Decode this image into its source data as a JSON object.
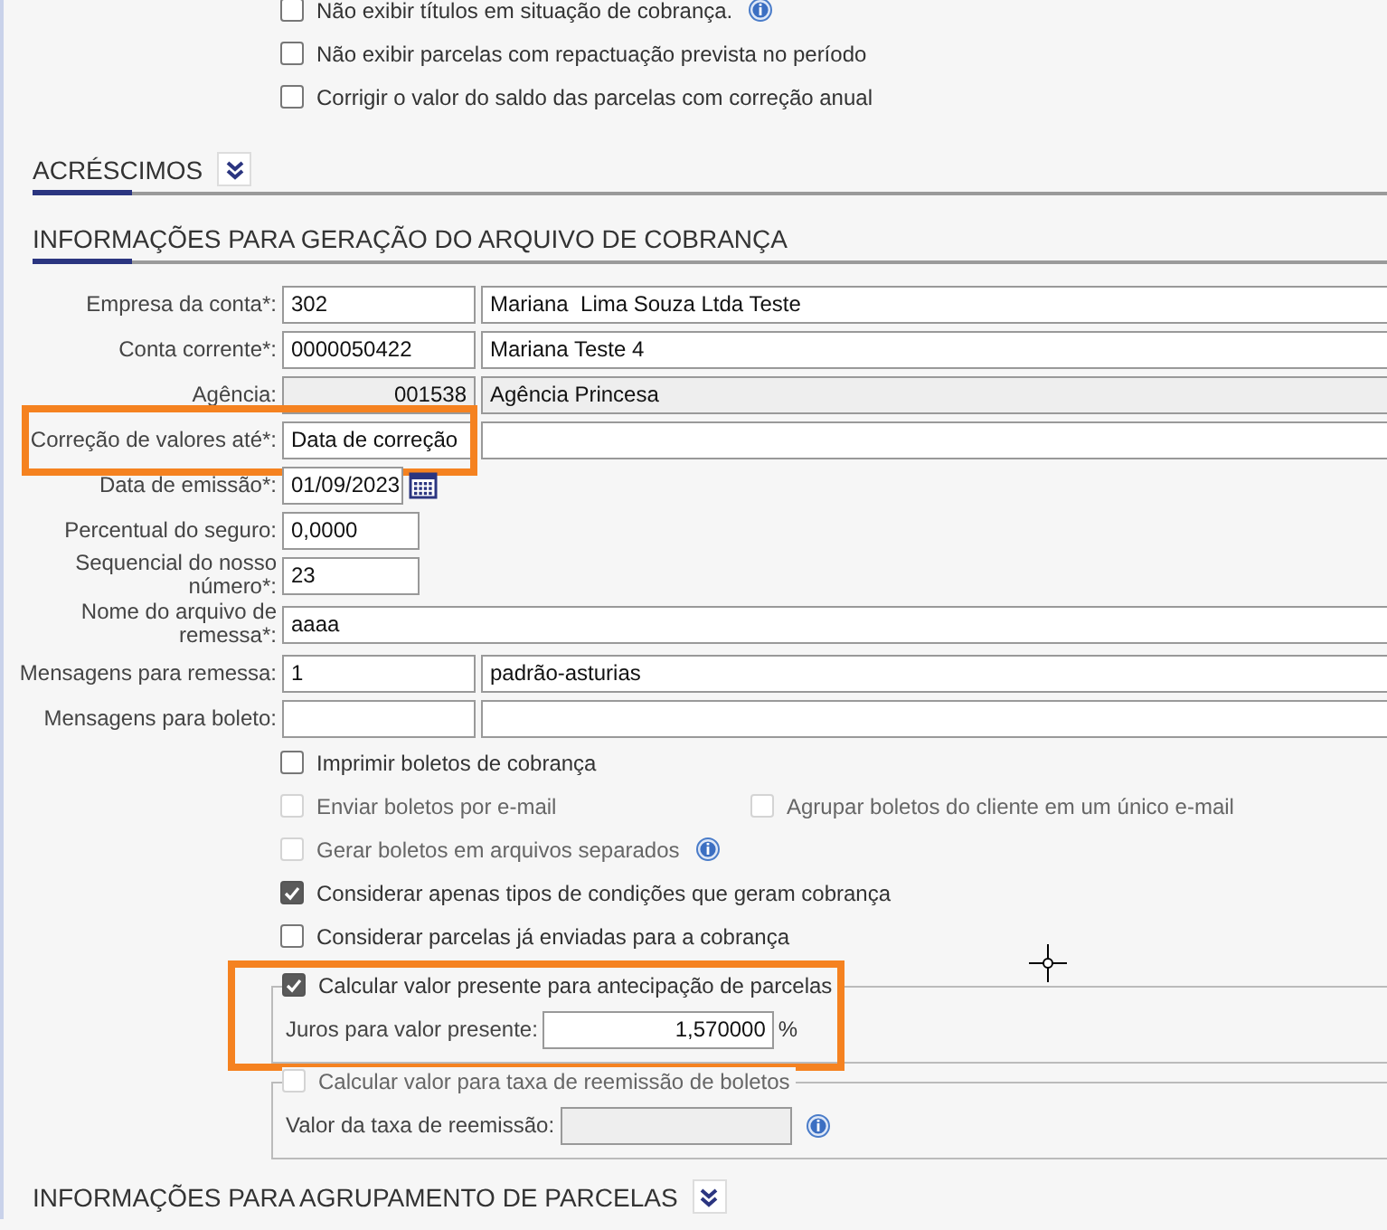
{
  "top_options": [
    {
      "label": "Não exibir títulos em situação de cobrança.",
      "checked": false,
      "disabled": false,
      "info": true
    },
    {
      "label": "Não exibir parcelas com repactuação prevista no período",
      "checked": false,
      "disabled": false,
      "info": false
    },
    {
      "label": "Corrigir o valor do saldo das parcelas com correção anual",
      "checked": false,
      "disabled": false,
      "info": false
    }
  ],
  "acrescimos": {
    "title": "ACRÉSCIMOS"
  },
  "generation": {
    "title": "INFORMAÇÕES PARA GERAÇÃO DO ARQUIVO DE COBRANÇA",
    "fields": [
      {
        "label": "Empresa da conta*:",
        "kind": "pair",
        "value": "302",
        "value_2": "Mariana  Lima Souza Ltda Teste",
        "disabled": false,
        "highlighted": false
      },
      {
        "label": "Conta corrente*:",
        "kind": "pair",
        "value": "0000050422",
        "value_2": "Mariana Teste 4",
        "disabled": false,
        "highlighted": false
      },
      {
        "label": "Agência:",
        "kind": "pair",
        "value": "001538",
        "value_2": "Agência Princesa",
        "disabled": true,
        "highlighted": false
      },
      {
        "label": "Correção de valores até*:",
        "kind": "pair",
        "value": "Data de correção",
        "disabled": false,
        "highlighted": true
      },
      {
        "label": "Data de emissão*:",
        "kind": "date",
        "value": "01/09/2023",
        "disabled": false,
        "highlighted": false
      },
      {
        "label": "Percentual do seguro:",
        "kind": "short",
        "value": "0,0000",
        "disabled": false,
        "highlighted": false
      },
      {
        "label": "Sequencial do nosso número*:",
        "kind": "short",
        "value": "23",
        "disabled": false,
        "highlighted": false
      },
      {
        "label": "Nome do arquivo de remessa*:",
        "kind": "wide",
        "value": "aaaa",
        "disabled": false,
        "highlighted": false
      },
      {
        "label": "Mensagens para remessa:",
        "kind": "pair",
        "value": "1",
        "value_2": "padrão-asturias",
        "disabled": false,
        "highlighted": false
      },
      {
        "label": "Mensagens para boleto:",
        "kind": "pair",
        "disabled": false,
        "highlighted": false
      }
    ],
    "options": [
      [
        {
          "label": "Imprimir boletos de cobrança",
          "checked": false,
          "disabled": false,
          "info": false
        }
      ],
      [
        {
          "label": "Enviar boletos por e-mail",
          "checked": false,
          "disabled": true,
          "info": false
        },
        {
          "label": "Agrupar boletos do cliente em um único e-mail",
          "checked": false,
          "disabled": true,
          "info": false
        }
      ],
      [
        {
          "label": "Gerar boletos em arquivos separados",
          "checked": false,
          "disabled": true,
          "info": true
        }
      ],
      [
        {
          "label": "Considerar apenas tipos de condições que geram cobrança",
          "checked": true,
          "disabled": false,
          "info": false
        }
      ],
      [
        {
          "label": "Considerar parcelas já enviadas para a cobrança",
          "checked": false,
          "disabled": false,
          "info": false
        }
      ]
    ],
    "groups": [
      {
        "legend": {
          "label": "Calcular valor presente para antecipação de parcelas",
          "checked": true,
          "disabled": false
        },
        "field": {
          "label": "Juros para valor presente:",
          "value": "1,570000",
          "suffix": "%",
          "disabled": false,
          "info": false
        },
        "highlighted": true
      },
      {
        "legend": {
          "label": "Calcular valor para taxa de reemissão de boletos",
          "checked": false,
          "disabled": true
        },
        "field": {
          "label": "Valor da taxa de reemissão:",
          "disabled": true,
          "info": true
        },
        "highlighted": false
      }
    ]
  },
  "next_section": {
    "title": "INFORMAÇÕES PARA AGRUPAMENTO DE PARCELAS"
  }
}
